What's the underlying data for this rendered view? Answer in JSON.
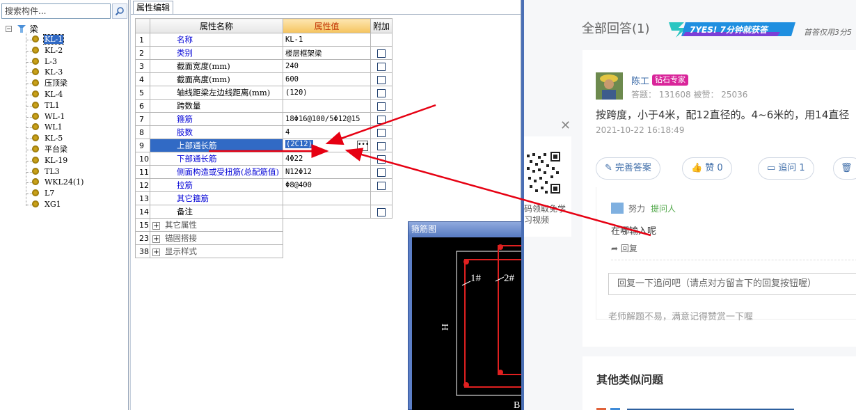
{
  "tree": {
    "search_placeholder": "搜索构件...",
    "root_label": "梁",
    "items": [
      "KL-1",
      "KL-2",
      "L-3",
      "KL-3",
      "压顶梁",
      "KL-4",
      "TL1",
      "WL-1",
      "WL1",
      "KL-5",
      "平台梁",
      "KL-19",
      "TL3",
      "WKL24(1)",
      "L7",
      "XG1"
    ],
    "selected": "KL-1"
  },
  "properties": {
    "tab_label": "属性编辑",
    "headers": {
      "name": "属性名称",
      "value": "属性值",
      "extra": "附加"
    },
    "rows": [
      {
        "num": "1",
        "name": "名称",
        "value": "KL-1",
        "blue": true,
        "checkbox": false
      },
      {
        "num": "2",
        "name": "类别",
        "value": "楼层框架梁",
        "blue": true,
        "checkbox": true
      },
      {
        "num": "3",
        "name": "截面宽度(mm)",
        "value": "240",
        "blue": false,
        "checkbox": true
      },
      {
        "num": "4",
        "name": "截面高度(mm)",
        "value": "600",
        "blue": false,
        "checkbox": true
      },
      {
        "num": "5",
        "name": "轴线距梁左边线距离(mm)",
        "value": "(120)",
        "blue": false,
        "checkbox": true
      },
      {
        "num": "6",
        "name": "跨数量",
        "value": "",
        "blue": false,
        "checkbox": true
      },
      {
        "num": "7",
        "name": "箍筋",
        "value": "18Φ16@100/5Φ12@15",
        "blue": true,
        "checkbox": true
      },
      {
        "num": "8",
        "name": "肢数",
        "value": "4",
        "blue": true,
        "checkbox": true
      },
      {
        "num": "9",
        "name": "上部通长筋",
        "value": "(2C12)",
        "blue": true,
        "checkbox": true,
        "selected": true
      },
      {
        "num": "10",
        "name": "下部通长筋",
        "value": "4Φ22",
        "blue": true,
        "checkbox": true
      },
      {
        "num": "11",
        "name": "侧面构造或受扭筋(总配筋值)",
        "value": "N12Φ12",
        "blue": true,
        "checkbox": true
      },
      {
        "num": "12",
        "name": "拉筋",
        "value": "Φ8@400",
        "blue": true,
        "checkbox": true
      },
      {
        "num": "13",
        "name": "其它箍筋",
        "value": "",
        "blue": true,
        "checkbox": false
      },
      {
        "num": "14",
        "name": "备注",
        "value": "",
        "blue": false,
        "checkbox": true
      }
    ],
    "groups": [
      {
        "num": "15",
        "name": "其它属性"
      },
      {
        "num": "23",
        "name": "锚固搭接"
      },
      {
        "num": "38",
        "name": "显示样式"
      }
    ]
  },
  "stirrup": {
    "title": "箍筋图",
    "label_1": "1#",
    "label_2": "2#",
    "label_h": "H",
    "label_b": "B"
  },
  "web": {
    "qr_text": "码领取免学习视频",
    "answers_title": "全部回答(1)",
    "badge_text": "7YES! 7分钟就获答",
    "first_tip": "首答仅用3分5",
    "author": "陈工",
    "expert_badge": "钻石专家",
    "author_stats": "答题： 131608    被赞： 25036",
    "answer_text": "按跨度，小于4米，配12直径的。4~6米的，用14直径",
    "answer_time": "2021-10-22 16:18:49",
    "buttons": {
      "improve": "完善答案",
      "like": "赞 0",
      "followup": "追问  1"
    },
    "followup": {
      "user": "努力",
      "role": "提问人",
      "text": "在哪输入呢",
      "reply": "回复",
      "input_placeholder": "回复一下追问吧（请点对方留言下的回复按钮喔）",
      "thanks": "老师解题不易，满意记得赞赏一下喔"
    },
    "similar_title": "其他类似问题"
  }
}
